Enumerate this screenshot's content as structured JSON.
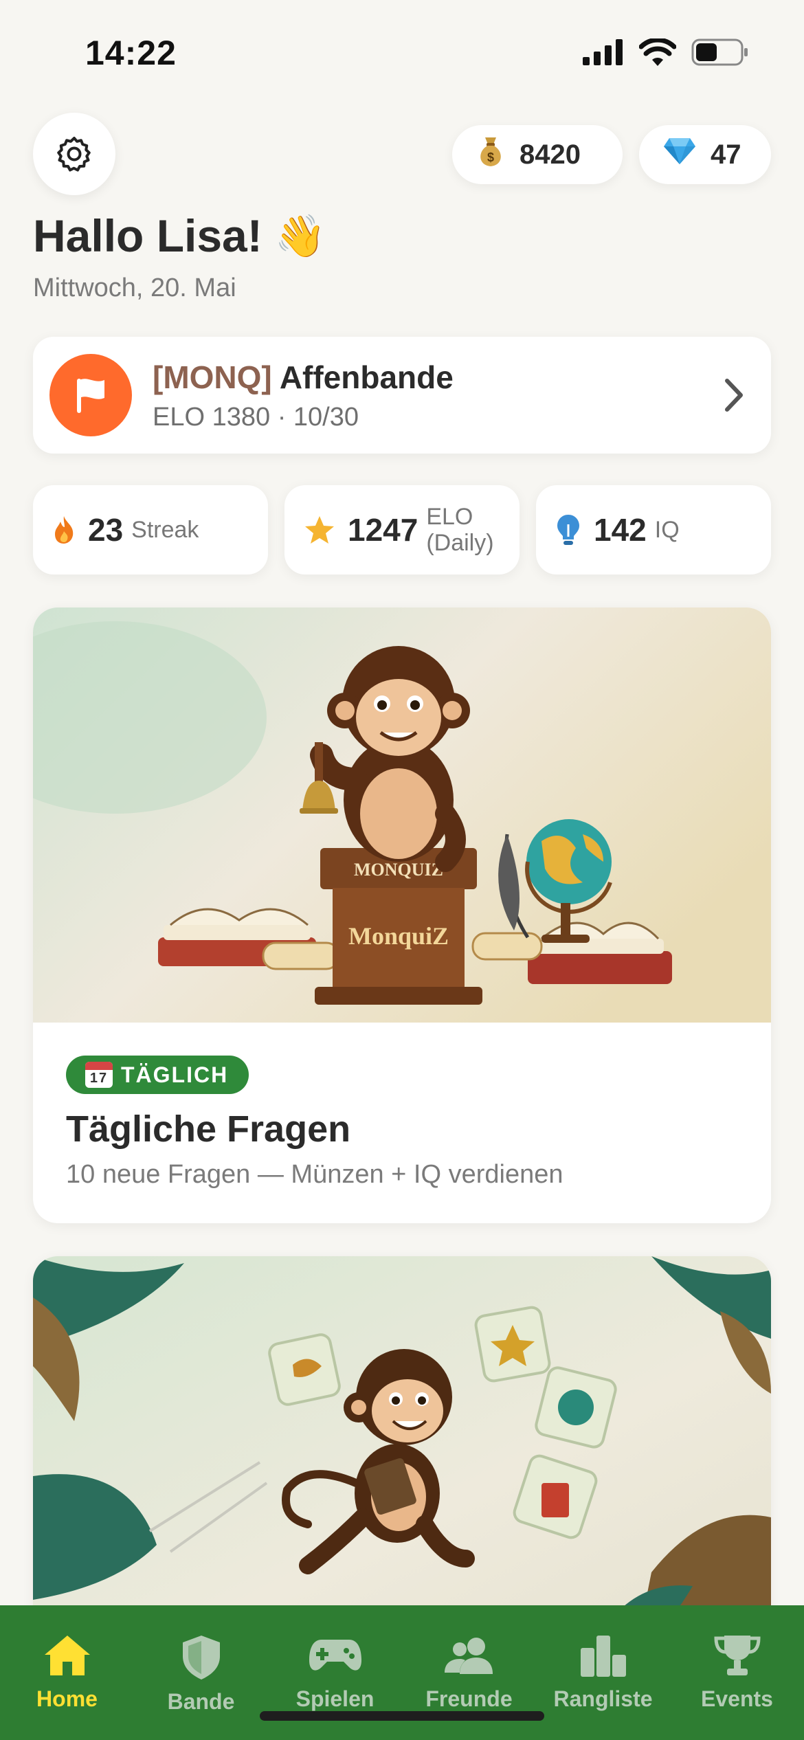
{
  "status_bar": {
    "time": "14:22"
  },
  "header": {
    "coins": "8420",
    "coins_icon": "money-bag-icon",
    "gems": "47",
    "gems_icon": "gem-icon"
  },
  "greeting": {
    "title": "Hallo Lisa!",
    "emoji": "👋",
    "date": "Mittwoch, 20. Mai"
  },
  "clan": {
    "tag": "[MONQ]",
    "name": "Affenbande",
    "meta": "ELO 1380 · 10/30",
    "avatar_color": "#ff6a2c"
  },
  "stats": [
    {
      "value": "23",
      "label": "Streak",
      "icon": "flame-icon"
    },
    {
      "value": "1247",
      "label_line1": "ELO",
      "label_line2": "(Daily)",
      "icon": "star-icon"
    },
    {
      "value": "142",
      "label": "IQ",
      "icon": "lightbulb-icon"
    }
  ],
  "daily_card": {
    "badge_icon_text": "17",
    "badge": "TÄGLICH",
    "title": "Tägliche Fragen",
    "subtitle": "10 neue Fragen — Münzen + IQ verdienen",
    "lectern_text": "MONQUIZ",
    "lectern_text_2": "MonquiZ"
  },
  "tabs": [
    {
      "label": "Home",
      "icon": "home-icon",
      "active": true
    },
    {
      "label": "Bande",
      "icon": "shield-icon",
      "active": false
    },
    {
      "label": "Spielen",
      "icon": "gamepad-icon",
      "active": false
    },
    {
      "label": "Freunde",
      "icon": "friends-icon",
      "active": false
    },
    {
      "label": "Rangliste",
      "icon": "leaderboard-icon",
      "active": false
    },
    {
      "label": "Events",
      "icon": "trophy-icon",
      "active": false
    }
  ],
  "colors": {
    "accent_green": "#2e7d32",
    "active_tab": "#ffe033",
    "badge_green": "#2f8a3a"
  }
}
